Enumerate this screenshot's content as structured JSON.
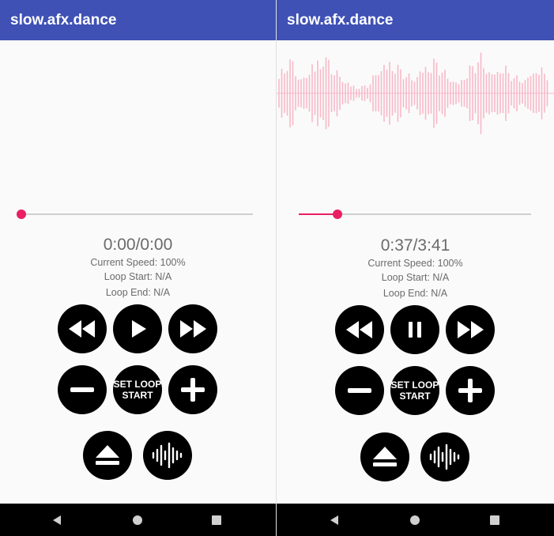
{
  "app": {
    "title": "slow.afx.dance"
  },
  "screens": [
    {
      "playing": false,
      "progress": 0,
      "time": "0:00/0:00",
      "speed": "Current Speed: 100%",
      "loop_start": "Loop Start: N/A",
      "loop_end": "Loop End: N/A",
      "set_loop_label": "SET LOOP\nSTART",
      "has_waveform": false
    },
    {
      "playing": true,
      "progress": 0.167,
      "time": "0:37/3:41",
      "speed": "Current Speed: 100%",
      "loop_start": "Loop Start: N/A",
      "loop_end": "Loop End: N/A",
      "set_loop_label": "SET LOOP\nSTART",
      "has_waveform": true
    }
  ],
  "colors": {
    "app_bar": "#3f51b5",
    "accent": "#e91e63",
    "waveform": "#f7b9c8",
    "button": "#000000",
    "nav_bar": "#000000"
  },
  "icons": {
    "rewind": "rewind-icon",
    "play": "play-icon",
    "pause": "pause-icon",
    "fast_forward": "fast-forward-icon",
    "speed_down": "minus-icon",
    "speed_up": "plus-icon",
    "eject": "eject-icon",
    "waveform": "waveform-icon",
    "nav_back": "back-triangle-icon",
    "nav_home": "home-circle-icon",
    "nav_recents": "recents-square-icon"
  }
}
